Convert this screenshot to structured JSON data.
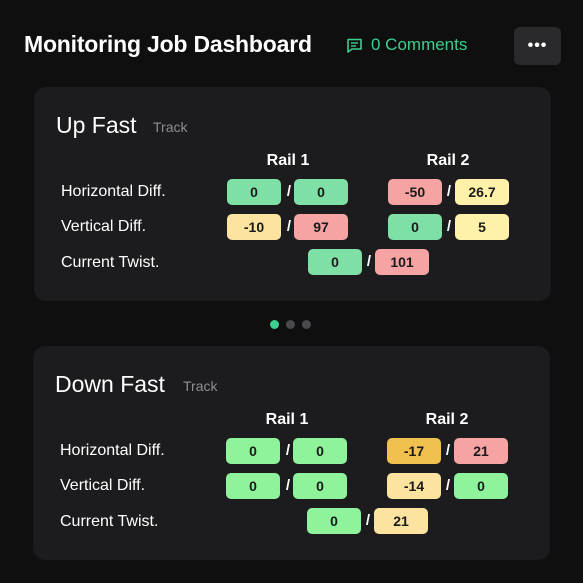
{
  "header": {
    "title": "Monitoring Job Dashboard",
    "comments_label": "0 Comments",
    "more_label": "•••",
    "icons": {
      "comments": "comment-icon",
      "more": "more-icon"
    }
  },
  "colors": {
    "background": "#0f0f10",
    "card": "#1c1c1e",
    "accent": "#3ccf8e",
    "pill_green": "#7fe0a6",
    "pill_light_green": "#8ff39c",
    "pill_red": "#f6a3a3",
    "pill_yellow": "#fff2a8",
    "pill_light_yellow": "#fde3a0",
    "pill_orange": "#f0c14f"
  },
  "cards": [
    {
      "title": "Up Fast",
      "subtitle": "Track",
      "rail1_label": "Rail 1",
      "rail2_label": "Rail 2",
      "rows": [
        {
          "label": "Horizontal Diff.",
          "rail1": [
            "0",
            "0"
          ],
          "rail2": [
            "-50",
            "26.7"
          ]
        },
        {
          "label": "Vertical Diff.",
          "rail1": [
            "-10",
            "97"
          ],
          "rail2": [
            "0",
            "5"
          ]
        }
      ],
      "twist": {
        "label": "Current Twist.",
        "values": [
          "0",
          "101"
        ]
      }
    },
    {
      "title": "Down Fast",
      "subtitle": "Track",
      "rail1_label": "Rail 1",
      "rail2_label": "Rail 2",
      "rows": [
        {
          "label": "Horizontal Diff.",
          "rail1": [
            "0",
            "0"
          ],
          "rail2": [
            "-17",
            "21"
          ]
        },
        {
          "label": "Vertical Diff.",
          "rail1": [
            "0",
            "0"
          ],
          "rail2": [
            "-14",
            "0"
          ]
        }
      ],
      "twist": {
        "label": "Current Twist.",
        "values": [
          "0",
          "21"
        ]
      }
    }
  ],
  "pager": {
    "count": 3,
    "active_index": 0
  },
  "separator": "/"
}
